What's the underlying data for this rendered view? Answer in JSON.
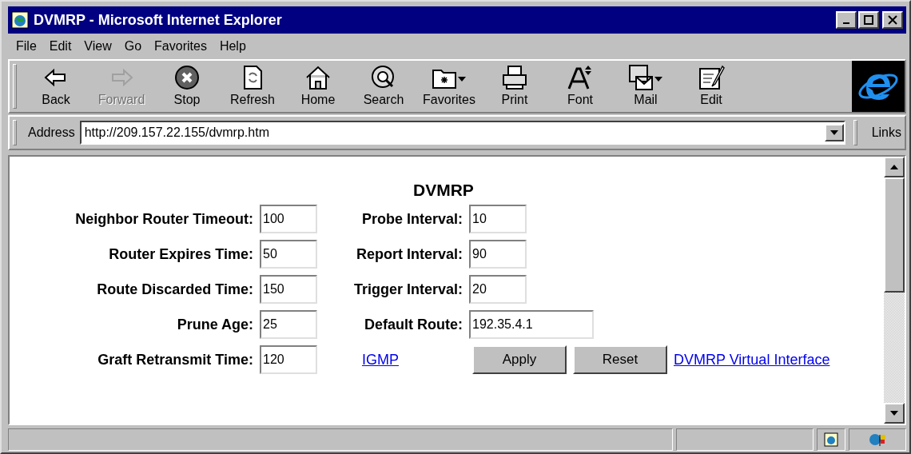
{
  "window": {
    "title": "DVMRP - Microsoft Internet Explorer"
  },
  "menu": [
    "File",
    "Edit",
    "View",
    "Go",
    "Favorites",
    "Help"
  ],
  "toolbar": [
    {
      "label": "Back",
      "disabled": false
    },
    {
      "label": "Forward",
      "disabled": true
    },
    {
      "label": "Stop",
      "disabled": false
    },
    {
      "label": "Refresh",
      "disabled": false
    },
    {
      "label": "Home",
      "disabled": false
    },
    {
      "label": "Search",
      "disabled": false
    },
    {
      "label": "Favorites",
      "disabled": false
    },
    {
      "label": "Print",
      "disabled": false
    },
    {
      "label": "Font",
      "disabled": false
    },
    {
      "label": "Mail",
      "disabled": false
    },
    {
      "label": "Edit",
      "disabled": false
    }
  ],
  "address": {
    "label": "Address",
    "value": "http://209.157.22.155/dvmrp.htm"
  },
  "links_label": "Links",
  "page": {
    "heading": "DVMRP",
    "rows": [
      {
        "label": "Neighbor Router Timeout:",
        "value": "100",
        "label2": "Probe Interval:",
        "value2": "10"
      },
      {
        "label": "Router Expires Time:",
        "value": "50",
        "label2": "Report Interval:",
        "value2": "90"
      },
      {
        "label": "Route Discarded Time:",
        "value": "150",
        "label2": "Trigger Interval:",
        "value2": "20"
      },
      {
        "label": "Prune Age:",
        "value": "25",
        "label2": "Default Route:",
        "value2": "192.35.4.1"
      },
      {
        "label": "Graft Retransmit Time:",
        "value": "120"
      }
    ],
    "igmp_link": "IGMP",
    "buttons": [
      "Apply",
      "Reset"
    ],
    "interface_link": "DVMRP Virtual Interface"
  }
}
